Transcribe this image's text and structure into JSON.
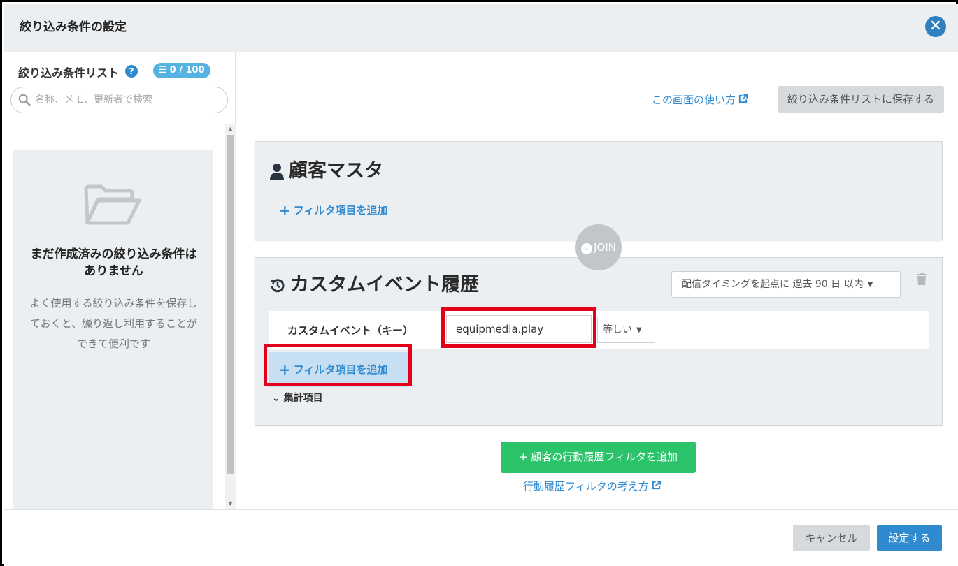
{
  "dialog": {
    "title": "絞り込み条件の設定",
    "close_icon": "close-icon"
  },
  "sidebar": {
    "heading": "絞り込み条件リスト",
    "help_icon": "?",
    "count_badge": "0 / 100",
    "search_placeholder": "名称、メモ、更新者で検索",
    "empty_title": "まだ作成済みの絞り込み条件はありません",
    "empty_description": "よく使用する絞り込み条件を保存しておくと、繰り返し利用することができて便利です"
  },
  "header": {
    "howto_link": "この画面の使い方",
    "save_list_button": "絞り込み条件リストに保存する"
  },
  "customer_master": {
    "title": "顧客マスタ",
    "add_filter": "フィルタ項目を追加"
  },
  "join_label": "JOIN",
  "custom_event": {
    "title": "カスタムイベント履歴",
    "timing_select": "配信タイミングを起点に 過去 90 日 以内",
    "condition_label": "カスタムイベント（キー）",
    "condition_value": "equipmedia.play",
    "operator": "等しい",
    "add_filter": "フィルタ項目を追加",
    "aggregate_toggle": "集計項目"
  },
  "add_history_button": "顧客の行動履歴フィルタを追加",
  "history_link": "行動履歴フィルタの考え方",
  "footer": {
    "cancel": "キャンセル",
    "apply": "設定する"
  },
  "colors": {
    "accent": "#2f8ad0",
    "success": "#2bc36a",
    "highlight": "#e2001a"
  }
}
